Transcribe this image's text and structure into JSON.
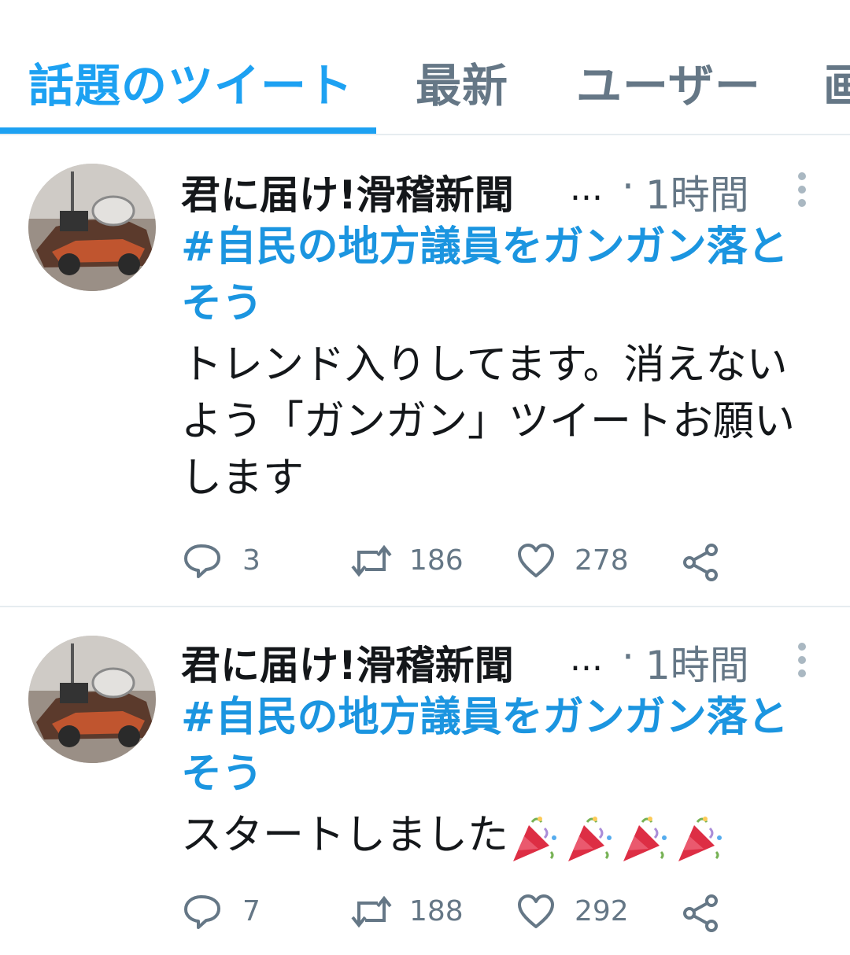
{
  "tabs": [
    {
      "label": "話題のツイート",
      "active": true
    },
    {
      "label": "最新",
      "active": false
    },
    {
      "label": "ユーザー",
      "active": false
    },
    {
      "label": "画",
      "active": false
    }
  ],
  "colors": {
    "accent": "#1da1f2",
    "hashtag": "#1b95e0",
    "secondary": "#657786"
  },
  "tweets": [
    {
      "user_name": "君に届け!滑稽新聞",
      "ellipsis": "...",
      "time": "1時間",
      "hashtag": "#自民の地方議員をガンガン落とそう",
      "text": "トレンド入りしてます。消えないよう「ガンガン」ツイートお願いします",
      "replies": "3",
      "retweets": "186",
      "likes": "278",
      "icons": [
        "reply-icon",
        "retweet-icon",
        "like-icon",
        "share-icon"
      ]
    },
    {
      "user_name": "君に届け!滑稽新聞",
      "ellipsis": "...",
      "time": "1時間",
      "hashtag": "#自民の地方議員をガンガン落とそう",
      "text": "スタートしました",
      "emoji": [
        "party-popper",
        "party-popper",
        "party-popper",
        "party-popper"
      ],
      "replies": "7",
      "retweets": "188",
      "likes": "292",
      "icons": [
        "reply-icon",
        "retweet-icon",
        "like-icon",
        "share-icon"
      ]
    }
  ]
}
